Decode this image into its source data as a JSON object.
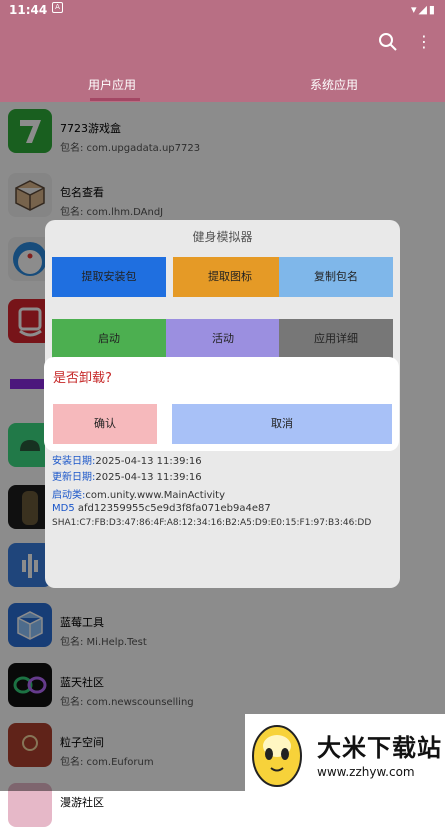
{
  "status_bar": {
    "time": "11:44",
    "notif": "A",
    "icons": "▾◢▮"
  },
  "app_bar": {
    "search_icon": "search-icon",
    "more_icon": "more-vertical-icon"
  },
  "tabs": [
    {
      "label": "用户应用"
    },
    {
      "label": "系统应用"
    }
  ],
  "apps": [
    {
      "name": "7723游戏盒",
      "pkg": "包名: com.upgadata.up7723"
    },
    {
      "name": "包名查看",
      "pkg": "包名: com.lhm.DAndJ"
    },
    {
      "name": "",
      "pkg": ""
    },
    {
      "name": "",
      "pkg": ""
    },
    {
      "name": "",
      "pkg": ""
    },
    {
      "name": "",
      "pkg": ""
    },
    {
      "name": "",
      "pkg": ""
    },
    {
      "name": "",
      "pkg": ""
    },
    {
      "name": "蓝莓工具",
      "pkg": "包名: Mi.Help.Test"
    },
    {
      "name": "蓝天社区",
      "pkg": "包名: com.newscounselling"
    },
    {
      "name": "粒子空间",
      "pkg": "包名: com.Euforum"
    },
    {
      "name": "漫游社区",
      "pkg": ""
    }
  ],
  "sheet": {
    "title": "健身模拟器",
    "buttons": [
      {
        "label": "提取安装包",
        "color": "#1f6fe0"
      },
      {
        "label": "提取图标",
        "color": "#e59a26"
      },
      {
        "label": "复制包名",
        "color": "#7fb7ea"
      },
      {
        "label": "启动",
        "color": "#4caf50"
      },
      {
        "label": "活动",
        "color": "#9b8fe0"
      },
      {
        "label": "应用详细",
        "color": "#777777"
      }
    ],
    "info": [
      {
        "key": "安装日期:",
        "value": "2025-04-13 11:39:16"
      },
      {
        "key": "更新日期:",
        "value": "2025-04-13 11:39:16"
      },
      {
        "key": "启动类:",
        "value": "com.unity.www.MainActivity"
      },
      {
        "key": "MD5",
        "value": " afd12359955c5e9d3f8fa071eb9a4e87"
      },
      {
        "key": "",
        "value": "SHA1:C7:FB:D3:47:86:4F:A8:12:34:16:B2:A5:D9:E0:15:F1:97:B3:46:DD"
      }
    ]
  },
  "dialog": {
    "title": "是否卸载?",
    "confirm": "确认",
    "cancel": "取消"
  },
  "watermark": {
    "title": "大米下载站",
    "url": "www.zzhyw.com"
  },
  "colors": {
    "primary": "#b86f84",
    "dialog_title": "#c62828"
  }
}
